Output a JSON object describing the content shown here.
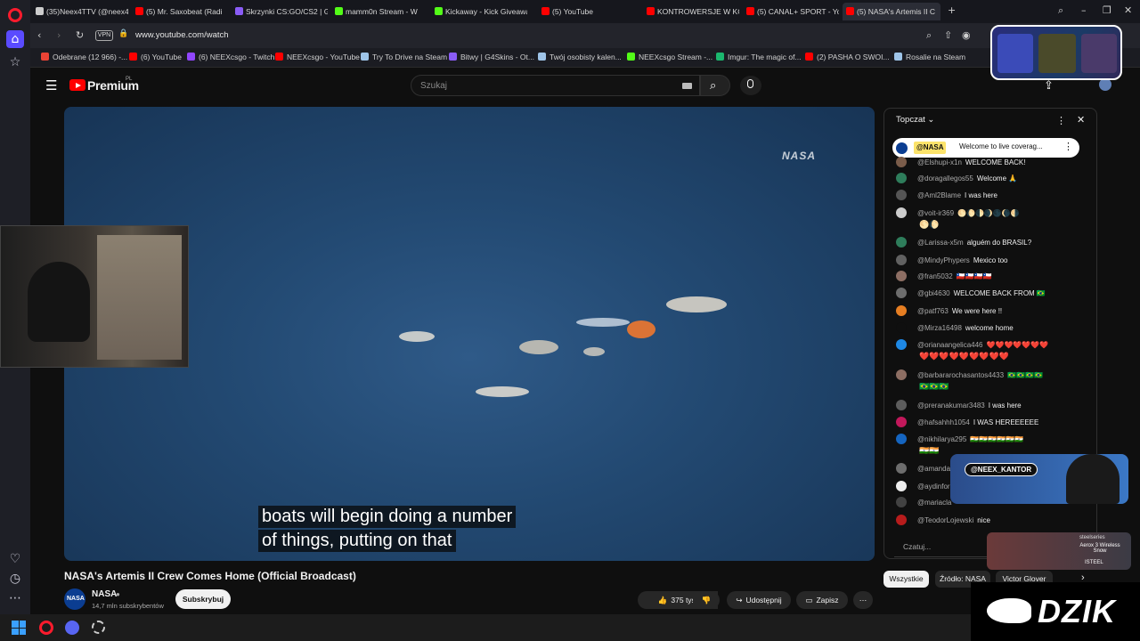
{
  "browser": {
    "tabs": [
      {
        "label": "(35)Neex4TTV (@neex4th",
        "color": "#cccccc"
      },
      {
        "label": "(5) Mr. Saxobeat (Radi",
        "color": "#ff0000"
      },
      {
        "label": "Skrzynki CS:GO/CS2 | G4S",
        "color": "#8a5cf6"
      },
      {
        "label": "mamm0n Stream - W",
        "color": "#53fc18"
      },
      {
        "label": "Kickaway - Kick Giveaway",
        "color": "#53fc18"
      },
      {
        "label": "(5) YouTube",
        "color": "#ff0000"
      },
      {
        "label": "KONTROWERSJE W KOŃC",
        "color": "#ff0000"
      },
      {
        "label": "(5) CANAL+ SPORT - YouT",
        "color": "#ff0000"
      },
      {
        "label": "(5) NASA's Artemis II C",
        "color": "#ff0000"
      }
    ],
    "vpn_label": "VPN",
    "url": "www.youtube.com/watch",
    "bookmarks": [
      {
        "label": "Odebrane (12 966) -...",
        "color": "#ea4335"
      },
      {
        "label": "(6) YouTube",
        "color": "#ff0000"
      },
      {
        "label": "(6) NEEXcsgo - Twitch",
        "color": "#9146ff"
      },
      {
        "label": "NEEXcsgo - YouTube",
        "color": "#ff0000"
      },
      {
        "label": "Try To Drive na Steam",
        "color": "#9ec4e8"
      },
      {
        "label": "Bitwy | G4Skins - Ot...",
        "color": "#8a5cf6"
      },
      {
        "label": "Twój osobisty kalen...",
        "color": "#9ec4e8"
      },
      {
        "label": "NEEXcsgo Stream -...",
        "color": "#53fc18"
      },
      {
        "label": "Imgur: The magic of...",
        "color": "#1bb76e"
      },
      {
        "label": "(2) PASHA O SWOI...",
        "color": "#ff0000"
      },
      {
        "label": "Rosalie na Steam",
        "color": "#9ec4e8"
      }
    ]
  },
  "youtube": {
    "logo_text": "Premium",
    "region": "PL",
    "search_placeholder": "Szukaj",
    "video": {
      "watermark": "NASA",
      "caption_lines": [
        "boats will begin doing a number",
        "of things, putting on that"
      ]
    },
    "title": "NASA's Artemis II Crew Comes Home (Official Broadcast)",
    "channel": {
      "name": "NASA",
      "avatar_text": "NASA",
      "subscribers": "14,7 mln subskrybentów"
    },
    "subscribe_label": "Subskrybuj",
    "actions": {
      "likes": "375 tys.",
      "share": "Udostępnij",
      "save": "Zapisz"
    },
    "chips": [
      "Wszystkie",
      "Źródło: NASA",
      "Victor Glover"
    ]
  },
  "chat": {
    "mode": "Topczat",
    "pinned": {
      "author": "@NASA",
      "text": "Welcome to live coverag..."
    },
    "messages": [
      {
        "author": "@Elshupi-x1n",
        "text": "WELCOME BACK!",
        "color": "#7a5c4a"
      },
      {
        "author": "@doragallegos55",
        "text": "Welcome 🙏",
        "color": "#2e7d5b"
      },
      {
        "author": "@Aml2Blame",
        "text": "I was here",
        "color": "#555555"
      },
      {
        "author": "@voit-ir369",
        "text": "🌕🌔🌓🌒🌑🌘🌗",
        "color": "#cccccc"
      },
      {
        "author": "@Larissa-x5m",
        "text": "alguém do BRASIL?",
        "color": "#2e7d5b"
      },
      {
        "author": "@MindyPhypers",
        "text": "Mexico too",
        "color": "#616161"
      },
      {
        "author": "@fran5032",
        "text": "🇨🇱🇨🇱🇨🇱🇨🇱",
        "color": "#8d6e63"
      },
      {
        "author": "@gbi4630",
        "text": "WELCOME BACK FROM 🇧🇷",
        "color": "#6d6d6d"
      },
      {
        "author": "@patf763",
        "text": "We were here !!",
        "color": "#e67e22"
      },
      {
        "author": "@Mirza16498",
        "text": "welcome home",
        "color": "#0f0f0f"
      },
      {
        "author": "@orianaangelica446",
        "text": "❤️❤️❤️❤️❤️❤️❤️",
        "color": "#1e88e5"
      },
      {
        "author": "@barbararochasantos4433",
        "text": "🇧🇷🇧🇷🇧🇷🇧🇷",
        "color": "#8d6e63"
      },
      {
        "author": "@preranakumar3483",
        "text": "I was here",
        "color": "#5d5d5d"
      },
      {
        "author": "@hafsahhh1054",
        "text": "I WAS HEREEEEEE",
        "color": "#c2185b"
      },
      {
        "author": "@nikhilarya295",
        "text": "🇮🇳🇮🇳🇮🇳🇮🇳🇮🇳🇮🇳",
        "color": "#1565c0"
      },
      {
        "author": "@amanda",
        "text": "",
        "color": "#6d6d6d"
      },
      {
        "author": "@aydinfor",
        "text": "",
        "color": "#eeeeee"
      },
      {
        "author": "@mariacla",
        "text": "",
        "color": "#424242"
      },
      {
        "author": "@TeodorLojewski",
        "text": "nice",
        "color": "#b71c1c"
      }
    ],
    "extra_emojis": [
      "🌕🌔",
      "❤️❤️❤️❤️❤️❤️❤️❤️❤️",
      "🇧🇷🇧🇷🇧🇷",
      "🇮🇳🇮🇳"
    ],
    "input_placeholder": "Czatuj..."
  },
  "overlays": {
    "neex_handle": "@NEEX_KANTOR",
    "aerox_brand": "steelseries",
    "aerox_text": "Aerox 3 Wireless Snow",
    "aerox_store": "ISTEEL",
    "dzik": "DZIK"
  },
  "colors": {
    "accent": "#ff0000",
    "opera": "#ff1b2d",
    "bg": "#0f0f0f"
  }
}
